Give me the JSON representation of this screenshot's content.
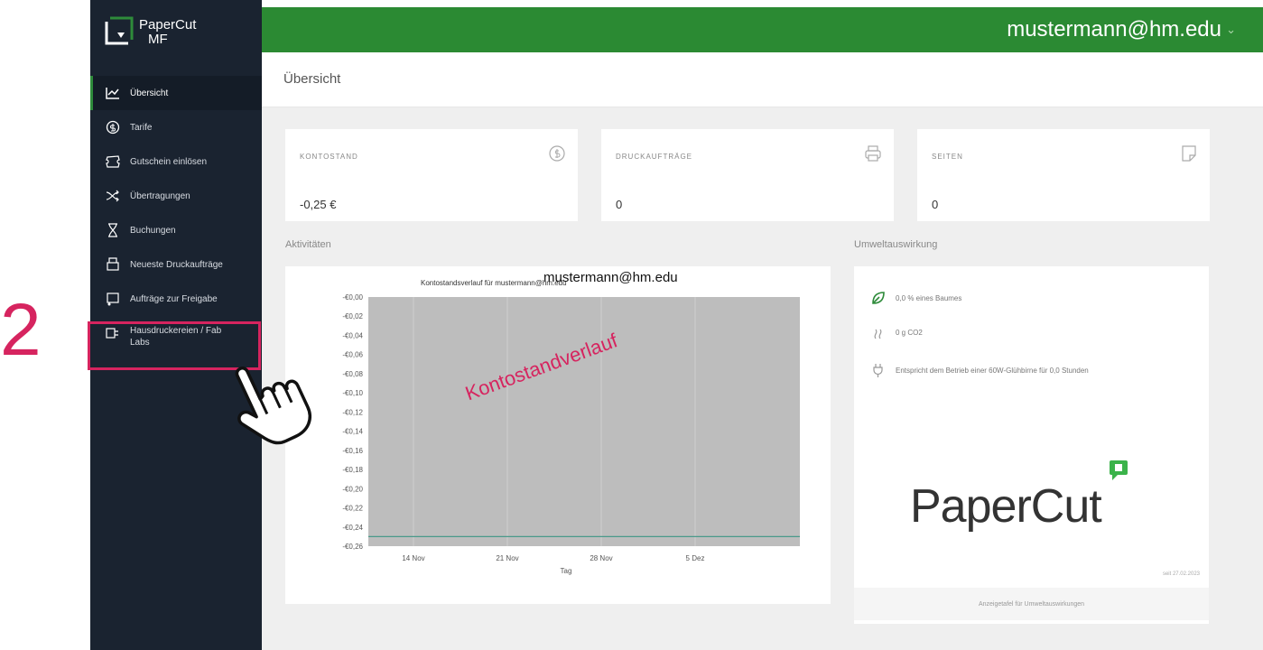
{
  "annotation": {
    "step_number": "2",
    "watermark": "Kontostandverlauf"
  },
  "header": {
    "user": "mustermann@hm.edu"
  },
  "brand": {
    "logo_line1": "PaperCut",
    "logo_line2": "MF",
    "wordmark": "PaperCut"
  },
  "sidebar": {
    "items": [
      {
        "label": "Übersicht"
      },
      {
        "label": "Tarife"
      },
      {
        "label": "Gutschein einlösen"
      },
      {
        "label": "Übertragungen"
      },
      {
        "label": "Buchungen"
      },
      {
        "label": "Neueste Druckaufträge"
      },
      {
        "label": "Aufträge zur Freigabe"
      },
      {
        "label": "Hausdruckereien / Fab Labs"
      }
    ]
  },
  "page": {
    "title": "Übersicht"
  },
  "stats": [
    {
      "label": "KONTOSTAND",
      "value": "-0,25 €"
    },
    {
      "label": "DRUCKAUFTRÄGE",
      "value": "0"
    },
    {
      "label": "SEITEN",
      "value": "0"
    }
  ],
  "sections": {
    "activities": "Aktivitäten",
    "environment": "Umweltauswirkung"
  },
  "environment": {
    "items": [
      {
        "text": "0,0 % eines Baumes"
      },
      {
        "text": "0 g CO2"
      },
      {
        "text": "Entspricht dem Betrieb einer 60W-Glühbirne für 0,0 Stunden"
      }
    ],
    "since": "seit 27.02.2023",
    "link": "Anzeigetafel für Umweltauswirkungen"
  },
  "chart_data": {
    "type": "area",
    "title": "Kontostandsverlauf für mustermann@hm.edu",
    "xlabel": "Tag",
    "ylabel": "",
    "xticks": [
      "14 Nov",
      "21 Nov",
      "28 Nov",
      "5 Dez"
    ],
    "yticks": [
      "-€0,00",
      "-€0,02",
      "-€0,04",
      "-€0,06",
      "-€0,08",
      "-€0,10",
      "-€0,12",
      "-€0,14",
      "-€0,16",
      "-€0,18",
      "-€0,20",
      "-€0,22",
      "-€0,24",
      "-€0,26"
    ],
    "ylim": [
      -0.26,
      0.0
    ],
    "series": [
      {
        "values": [
          -0.25,
          -0.25,
          -0.25,
          -0.25,
          -0.25
        ]
      }
    ],
    "grid": true
  },
  "colors": {
    "header_green": "#2b8a33",
    "sidebar": "#1a2330",
    "annotation": "#d6245f"
  }
}
